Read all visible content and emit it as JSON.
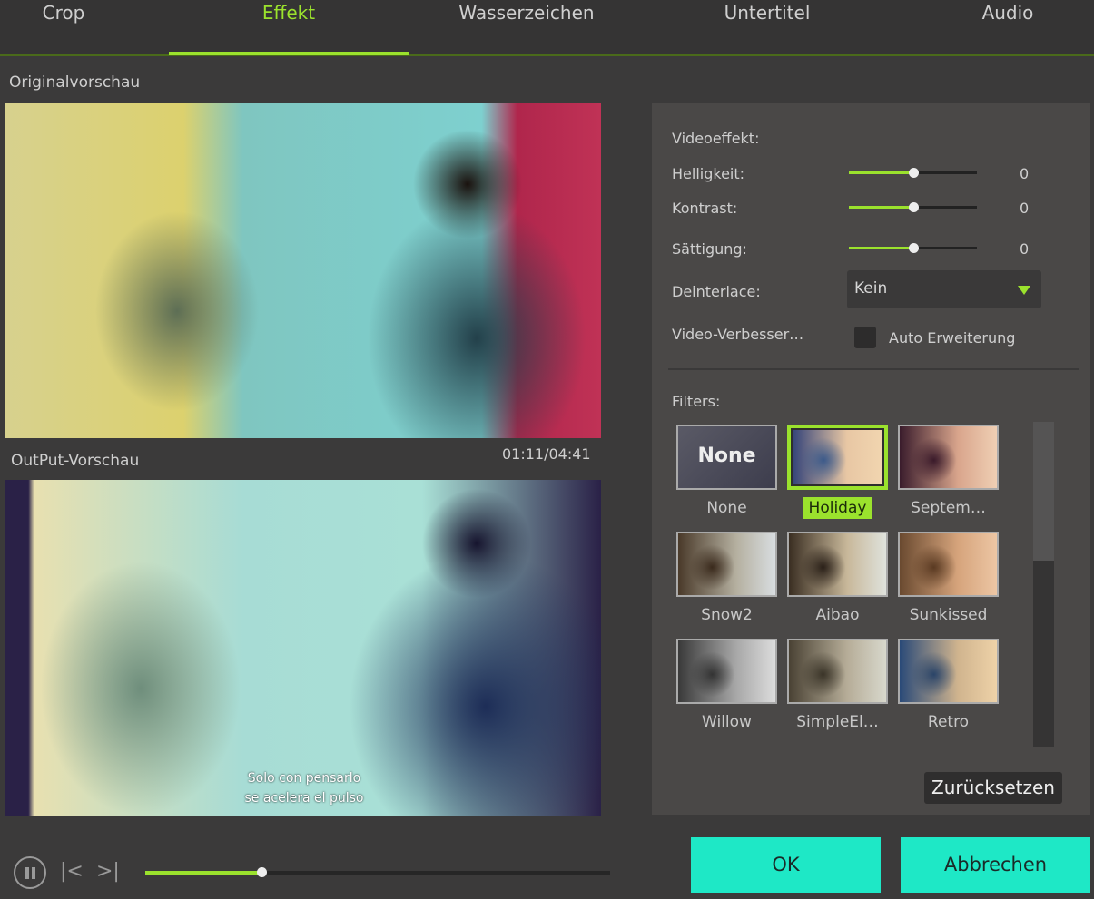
{
  "tabs": [
    "Crop",
    "Effekt",
    "Wasserzeichen",
    "Untertitel",
    "Audio"
  ],
  "active_tab": "Effekt",
  "original_preview_label": "Originalvorschau",
  "output_preview_label": "OutPut-Vorschau",
  "timecode": "01:11/04:41",
  "subtitle_lines": [
    "Solo con pensarlo",
    "se acelera el pulso"
  ],
  "video_effect": {
    "title": "Videoeffekt:",
    "brightness": {
      "label": "Helligkeit:",
      "value": "0",
      "slider_fraction": 0.5
    },
    "contrast": {
      "label": "Kontrast:",
      "value": "0",
      "slider_fraction": 0.5
    },
    "saturation": {
      "label": "Sättigung:",
      "value": "0",
      "slider_fraction": 0.5
    },
    "deinterlace": {
      "label": "Deinterlace:",
      "selected": "Kein"
    },
    "enhance": {
      "label": "Video-Verbesser…",
      "checkbox_label": "Auto Erweiterung",
      "checked": false
    }
  },
  "filters": {
    "title": "Filters:",
    "none_thumb_text": "None",
    "items": [
      "None",
      "Holiday",
      "Septem…",
      "Snow2",
      "Aibao",
      "Sunkissed",
      "Willow",
      "SimpleEl…",
      "Retro"
    ],
    "selected": "Holiday"
  },
  "reset_label": "Zurücksetzen",
  "ok_label": "OK",
  "cancel_label": "Abbrechen",
  "playback": {
    "progress_fraction": 0.25
  },
  "colors": {
    "accent": "#9be22d",
    "button": "#1ee8c6"
  }
}
